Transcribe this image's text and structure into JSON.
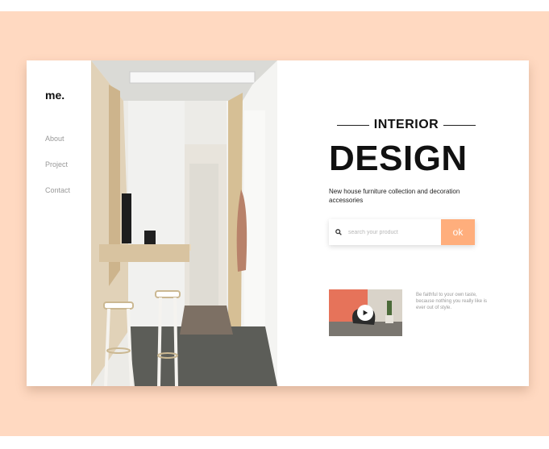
{
  "logo": "me.",
  "nav": [
    "About",
    "Project",
    "Contact"
  ],
  "hero": {
    "kicker": "INTERIOR",
    "headline": "DESIGN",
    "subtitle": "New house furniture collection and decoration accessories"
  },
  "search": {
    "placeholder": "search your product",
    "button_label": "ok"
  },
  "video": {
    "caption": "Be faithful to your own taste, because nothing you really like is ever out of style."
  },
  "colors": {
    "backdrop": "#ffd9c1",
    "accent": "#ffae7c"
  },
  "icons": [
    "search-icon",
    "play-icon"
  ]
}
